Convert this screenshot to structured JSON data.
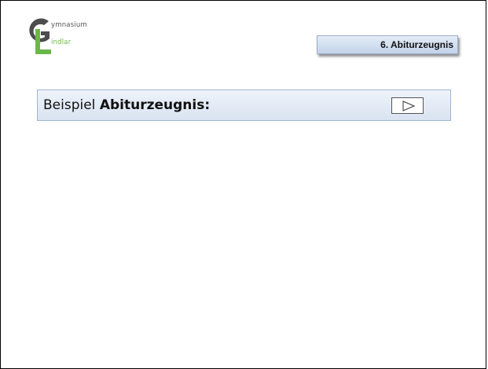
{
  "logo": {
    "letter_g": "G",
    "letter_l": "L",
    "word1": "ymnasium",
    "word2": "indlar",
    "colors": {
      "g": "#555555",
      "l": "#6ab84a"
    }
  },
  "section_tag": {
    "label": "6. Abiturzeugnis"
  },
  "title_bar": {
    "prefix": "Beispiel ",
    "bold": "Abiturzeugnis:",
    "play_icon": "play-icon"
  },
  "colors": {
    "title_bar_bg": "#dce6f2",
    "title_bar_border": "#9fb5d6",
    "tag_bg": "#c6d6ec"
  }
}
